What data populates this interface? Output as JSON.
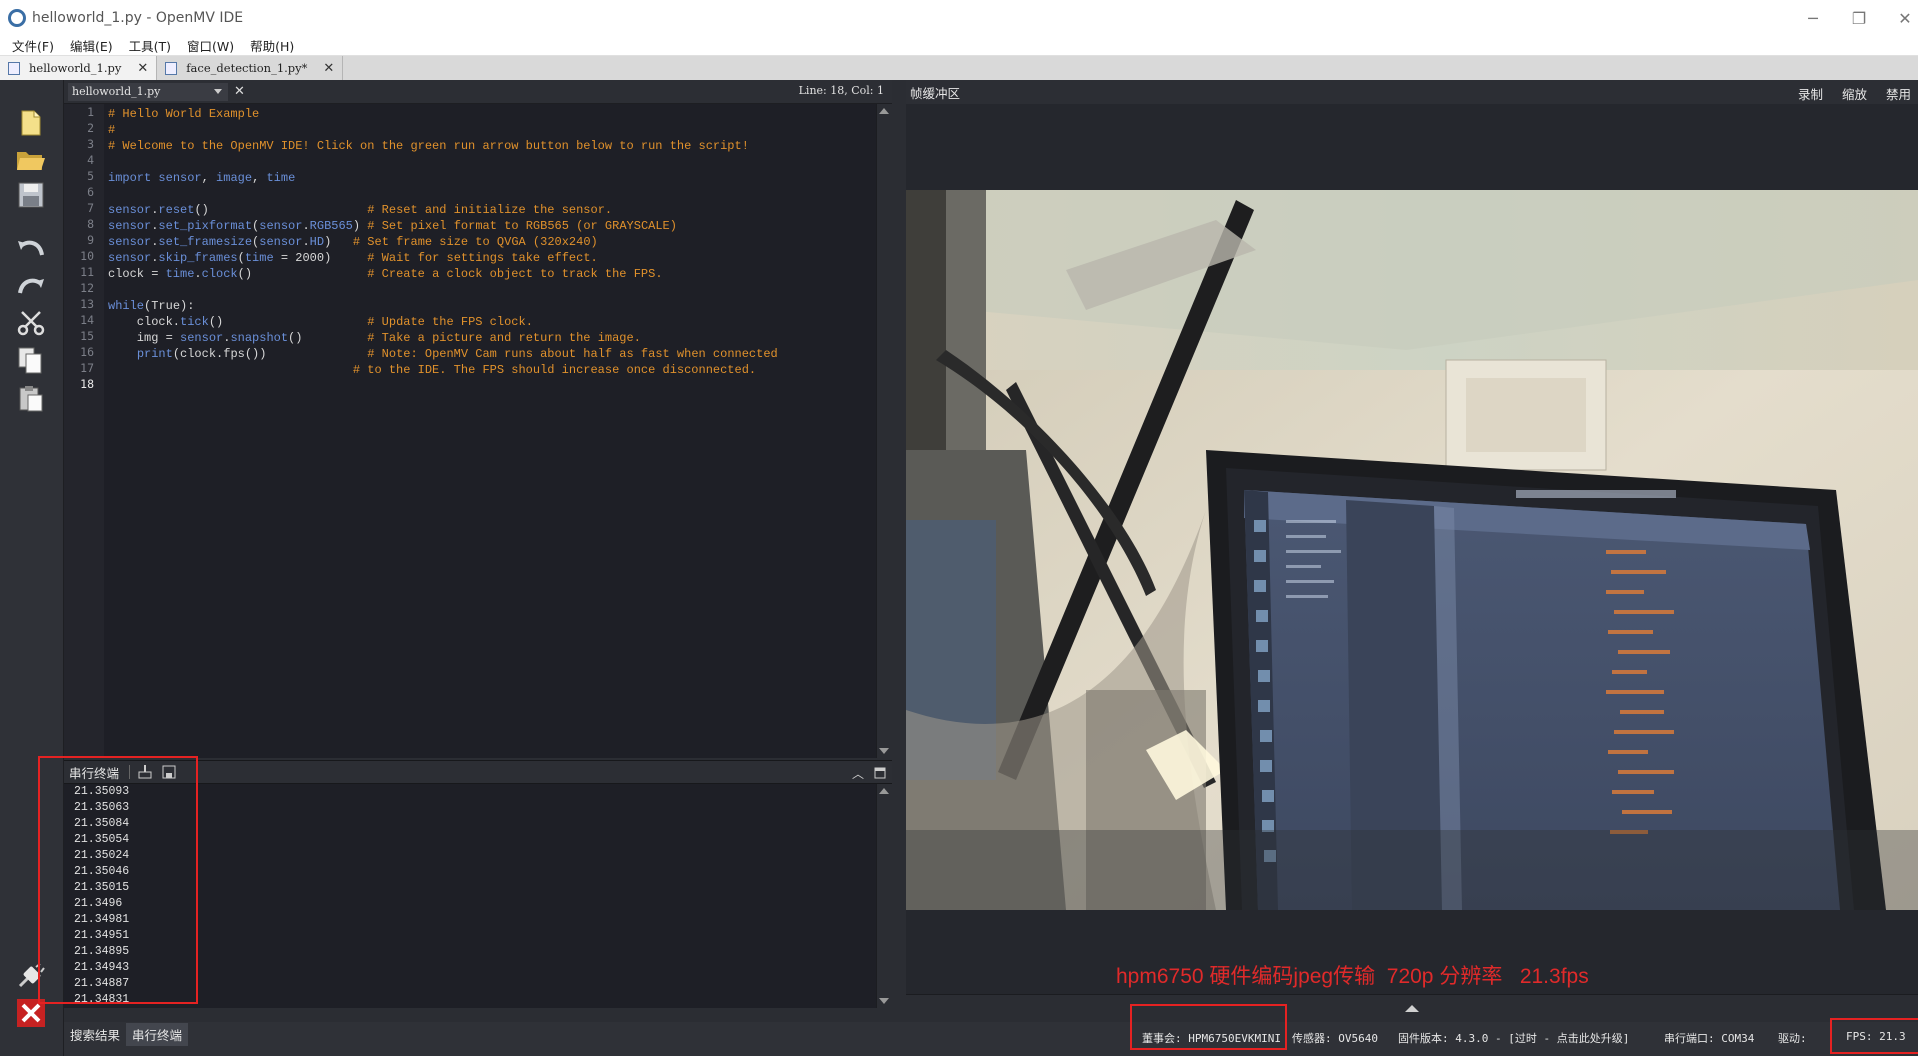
{
  "window": {
    "title": "helloworld_1.py - OpenMV IDE",
    "controls": [
      "minimize",
      "restore",
      "close"
    ]
  },
  "menu": [
    "文件(F)",
    "编辑(E)",
    "工具(T)",
    "窗口(W)",
    "帮助(H)"
  ],
  "tabs": [
    {
      "label": "helloworld_1.py",
      "active": true
    },
    {
      "label": "face_detection_1.py*",
      "active": false
    }
  ],
  "toolbar": [
    "new-file",
    "open-file",
    "save-file",
    "undo",
    "redo",
    "cut",
    "copy",
    "paste",
    "connect",
    "disconnect"
  ],
  "editor": {
    "file_combo": "helloworld_1.py",
    "cursor": "Line: 18, Col: 1",
    "current_line": 18,
    "lines": [
      [
        [
          "c",
          "# Hello World Example"
        ]
      ],
      [
        [
          "c",
          "#"
        ]
      ],
      [
        [
          "c",
          "# Welcome to the OpenMV IDE! Click on the green run arrow button below to run the script!"
        ]
      ],
      [],
      [
        [
          "k",
          "import"
        ],
        [
          "p",
          " "
        ],
        [
          "k",
          "sensor"
        ],
        [
          "p",
          ", "
        ],
        [
          "k",
          "image"
        ],
        [
          "p",
          ", "
        ],
        [
          "k",
          "time"
        ]
      ],
      [],
      [
        [
          "k",
          "sensor"
        ],
        [
          "p",
          "."
        ],
        [
          "k",
          "reset"
        ],
        [
          "p",
          "()                      "
        ],
        [
          "c",
          "# Reset and initialize the sensor."
        ]
      ],
      [
        [
          "k",
          "sensor"
        ],
        [
          "p",
          "."
        ],
        [
          "k",
          "set_pixformat"
        ],
        [
          "p",
          "("
        ],
        [
          "k",
          "sensor"
        ],
        [
          "p",
          "."
        ],
        [
          "k",
          "RGB565"
        ],
        [
          "p",
          ") "
        ],
        [
          "c",
          "# Set pixel format to RGB565 (or GRAYSCALE)"
        ]
      ],
      [
        [
          "k",
          "sensor"
        ],
        [
          "p",
          "."
        ],
        [
          "k",
          "set_framesize"
        ],
        [
          "p",
          "("
        ],
        [
          "k",
          "sensor"
        ],
        [
          "p",
          "."
        ],
        [
          "k",
          "HD"
        ],
        [
          "p",
          ")   "
        ],
        [
          "c",
          "# Set frame size to QVGA (320x240)"
        ]
      ],
      [
        [
          "k",
          "sensor"
        ],
        [
          "p",
          "."
        ],
        [
          "k",
          "skip_frames"
        ],
        [
          "p",
          "("
        ],
        [
          "k",
          "time"
        ],
        [
          "p",
          " = 2000)     "
        ],
        [
          "c",
          "# Wait for settings take effect."
        ]
      ],
      [
        [
          "p",
          "clock = "
        ],
        [
          "k",
          "time"
        ],
        [
          "p",
          "."
        ],
        [
          "k",
          "clock"
        ],
        [
          "p",
          "()                "
        ],
        [
          "c",
          "# Create a clock object to track the FPS."
        ]
      ],
      [],
      [
        [
          "k",
          "while"
        ],
        [
          "p",
          "(True):"
        ]
      ],
      [
        [
          "p",
          "    clock."
        ],
        [
          "k",
          "tick"
        ],
        [
          "p",
          "()                    "
        ],
        [
          "c",
          "# Update the FPS clock."
        ]
      ],
      [
        [
          "p",
          "    img = "
        ],
        [
          "k",
          "sensor"
        ],
        [
          "p",
          "."
        ],
        [
          "k",
          "snapshot"
        ],
        [
          "p",
          "()         "
        ],
        [
          "c",
          "# Take a picture and return the image."
        ]
      ],
      [
        [
          "p",
          "    "
        ],
        [
          "k",
          "print"
        ],
        [
          "p",
          "(clock.fps())              "
        ],
        [
          "c",
          "# Note: OpenMV Cam runs about half as fast when connected"
        ]
      ],
      [
        [
          "p",
          "                                  "
        ],
        [
          "c",
          "# to the IDE. The FPS should increase once disconnected."
        ]
      ],
      []
    ]
  },
  "terminal": {
    "title": "串行终端",
    "values": [
      "21.35093",
      "21.35063",
      "21.35084",
      "21.35054",
      "21.35024",
      "21.35046",
      "21.35015",
      "21.3496",
      "21.34981",
      "21.34951",
      "21.34895",
      "21.34943",
      "21.34887",
      "21.34831"
    ]
  },
  "bottom_tabs": [
    "搜索结果",
    "串行终端"
  ],
  "frame_buffer": {
    "title": "帧缓冲区",
    "actions": [
      "录制",
      "缩放",
      "禁用"
    ],
    "caption": "hpm6750 硬件编码jpeg传输  720p 分辨率   21.3fps"
  },
  "status": {
    "board": "董事会: HPM6750EVKMINI",
    "sensor": "传感器: OV5640",
    "firmware": "固件版本: 4.3.0 - [过时 - 点击此处升级]",
    "port": "串行端口: COM34",
    "driver": "驱动:",
    "fps": "FPS: 21.3"
  },
  "colors": {
    "accent_red": "#e52222",
    "comment": "#e0912c",
    "keyword": "#6a8fd8"
  }
}
